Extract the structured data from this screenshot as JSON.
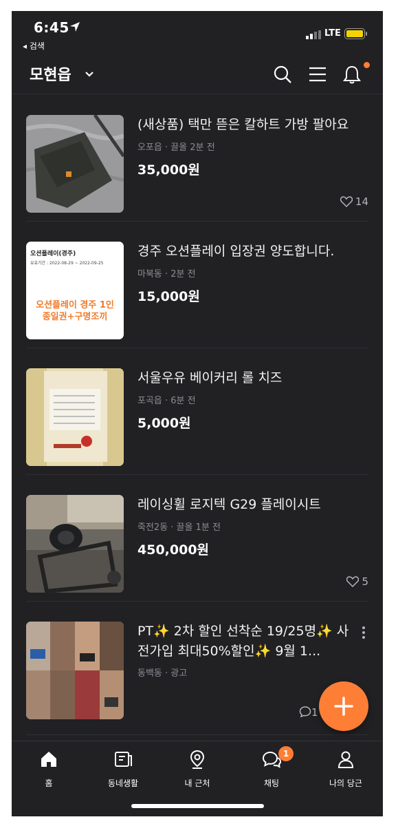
{
  "status_bar": {
    "time": "6:45",
    "back_label": "◂ 검색",
    "network": "LTE"
  },
  "header": {
    "location": "모현읍"
  },
  "items": [
    {
      "title": "(새상품) 택만 뜯은 칼하트 가방 팔아요",
      "meta": "오포읍 · 끌올 2분 전",
      "price": "35,000원",
      "likes": "14"
    },
    {
      "title": "경주 오션플레이 입장권 양도합니다.",
      "meta": "마북동 · 2분 전",
      "price": "15,000원",
      "likes": "",
      "thumb_title": "오션플레이(경주)",
      "thumb_period": "유효기간 : 2022-08-29 ~ 2022-09-25",
      "thumb_text": "오션플레이 경주 1인 종일권+구명조끼"
    },
    {
      "title": "서울우유 베이커리 롤 치즈",
      "meta": "포곡읍 · 6분 전",
      "price": "5,000원",
      "likes": ""
    },
    {
      "title": "레이싱휠 로지텍 G29 플레이시트",
      "meta": "죽전2동 · 끌올 1분 전",
      "price": "450,000원",
      "likes": "5"
    },
    {
      "title": "PT✨ 2차 할인 선착순 19/25명✨ 사전가입 최대50%할인✨ 9월 1...",
      "meta": "동백동 · 광고",
      "price": "",
      "chats": "1"
    }
  ],
  "bottom_nav": [
    {
      "label": "홈",
      "icon": "home-icon"
    },
    {
      "label": "동네생활",
      "icon": "community-icon"
    },
    {
      "label": "내 근처",
      "icon": "location-pin-icon"
    },
    {
      "label": "채팅",
      "icon": "chat-icon",
      "badge": "1"
    },
    {
      "label": "나의 당근",
      "icon": "person-icon"
    }
  ],
  "colors": {
    "background": "#212124",
    "accent": "#ff7e36",
    "meta_text": "#8b8d93"
  }
}
